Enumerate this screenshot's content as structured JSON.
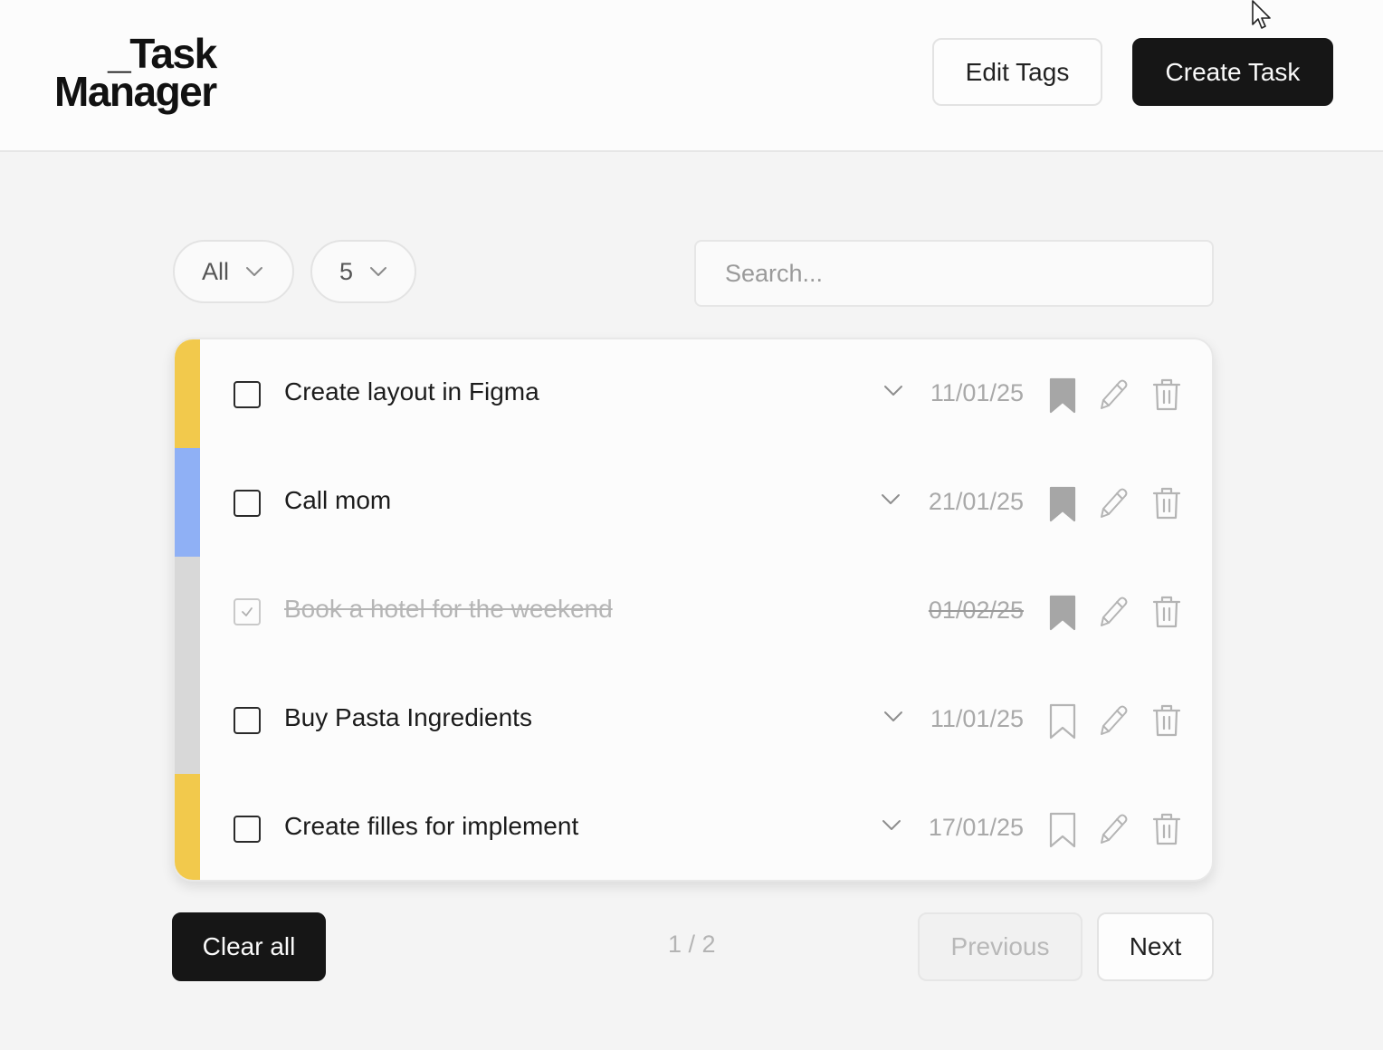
{
  "header": {
    "logo_line1": "_Task",
    "logo_line2": "Manager",
    "edit_tags_label": "Edit Tags",
    "create_task_label": "Create Task"
  },
  "filters": {
    "status_value": "All",
    "page_size_value": "5",
    "search_placeholder": "Search...",
    "search_value": ""
  },
  "tasks": [
    {
      "title": "Create layout in Figma",
      "date": "11/01/25",
      "completed": false,
      "bookmarked": true,
      "tag_color": "#f2c94c",
      "expandable": true
    },
    {
      "title": "Call mom",
      "date": "21/01/25",
      "completed": false,
      "bookmarked": true,
      "tag_color": "#8fb0f5",
      "expandable": true
    },
    {
      "title": "Book a hotel for the weekend",
      "date": "01/02/25",
      "completed": true,
      "bookmarked": true,
      "tag_color": "#d8d8d8",
      "expandable": false
    },
    {
      "title": "Buy Pasta Ingredients",
      "date": "11/01/25",
      "completed": false,
      "bookmarked": false,
      "tag_color": "#d8d8d8",
      "expandable": true
    },
    {
      "title": "Create filles for implement",
      "date": "17/01/25",
      "completed": false,
      "bookmarked": false,
      "tag_color": "#f2c94c",
      "expandable": true
    }
  ],
  "footer": {
    "clear_all_label": "Clear all",
    "page_indicator": "1 / 2",
    "previous_label": "Previous",
    "next_label": "Next"
  },
  "icons": {
    "checkbox": "checkbox-icon",
    "expand": "chevron-down-icon",
    "bookmark": "bookmark-icon",
    "edit": "pencil-icon",
    "delete": "trash-icon"
  }
}
